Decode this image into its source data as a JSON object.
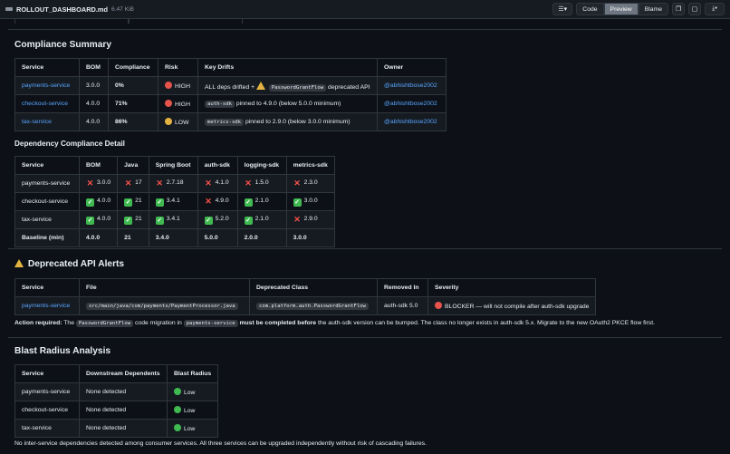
{
  "file": {
    "name": "ROLLOUT_DASHBOARD.md",
    "size": "6.47 KiB"
  },
  "toolbar": {
    "code": "Code",
    "preview": "Preview",
    "blame": "Blame"
  },
  "compliance": {
    "title": "Compliance Summary",
    "headers": [
      "Service",
      "BOM",
      "Compliance",
      "Risk",
      "Key Drifts",
      "Owner"
    ],
    "rows": [
      {
        "service": "payments-service",
        "bom": "3.0.0",
        "compliance": "0%",
        "risk": "HIGH",
        "risk_color": "#e5534b",
        "drift_pre": "ALL deps drifted +",
        "drift_code": "PasswordGrantFlow",
        "drift_post": "deprecated API",
        "owner": "@abhishtbose2002"
      },
      {
        "service": "checkout-service",
        "bom": "4.0.0",
        "compliance": "71%",
        "risk": "HIGH",
        "risk_color": "#e5534b",
        "drift_pre": "",
        "drift_code": "auth-sdk",
        "drift_post": "pinned to 4.9.0 (below 5.0.0 minimum)",
        "owner": "@abhishtbose2002"
      },
      {
        "service": "tax-service",
        "bom": "4.0.0",
        "compliance": "86%",
        "risk": "LOW",
        "risk_color": "#e3b341",
        "drift_pre": "",
        "drift_code": "metrics-sdk",
        "drift_post": "pinned to 2.9.0 (below 3.0.0 minimum)",
        "owner": "@abhishtbose2002"
      }
    ]
  },
  "dependency": {
    "title": "Dependency Compliance Detail",
    "headers": [
      "Service",
      "BOM",
      "Java",
      "Spring Boot",
      "auth-sdk",
      "logging-sdk",
      "metrics-sdk"
    ],
    "rows": [
      {
        "service": "payments-service",
        "cells": [
          {
            "ok": false,
            "v": "3.0.0"
          },
          {
            "ok": false,
            "v": "17"
          },
          {
            "ok": false,
            "v": "2.7.18"
          },
          {
            "ok": false,
            "v": "4.1.0"
          },
          {
            "ok": false,
            "v": "1.5.0"
          },
          {
            "ok": false,
            "v": "2.3.0"
          }
        ]
      },
      {
        "service": "checkout-service",
        "cells": [
          {
            "ok": true,
            "v": "4.0.0"
          },
          {
            "ok": true,
            "v": "21"
          },
          {
            "ok": true,
            "v": "3.4.1"
          },
          {
            "ok": false,
            "v": "4.9.0"
          },
          {
            "ok": true,
            "v": "2.1.0"
          },
          {
            "ok": true,
            "v": "3.0.0"
          }
        ]
      },
      {
        "service": "tax-service",
        "cells": [
          {
            "ok": true,
            "v": "4.0.0"
          },
          {
            "ok": true,
            "v": "21"
          },
          {
            "ok": true,
            "v": "3.4.1"
          },
          {
            "ok": true,
            "v": "5.2.0"
          },
          {
            "ok": true,
            "v": "2.1.0"
          },
          {
            "ok": false,
            "v": "2.9.0"
          }
        ]
      }
    ],
    "baseline": {
      "label": "Baseline (min)",
      "values": [
        "4.0.0",
        "21",
        "3.4.0",
        "5.0.0",
        "2.0.0",
        "3.0.0"
      ]
    }
  },
  "deprecated": {
    "title": "Deprecated API Alerts",
    "headers": [
      "Service",
      "File",
      "Deprecated Class",
      "Removed In",
      "Severity"
    ],
    "row": {
      "service": "payments-service",
      "file": "src/main/java/com/payments/PaymentProcessor.java",
      "klass": "com.platform.auth.PasswordGrantFlow",
      "removed": "auth-sdk 5.0",
      "severity": "BLOCKER — will not compile after auth-sdk upgrade"
    },
    "action": {
      "label": "Action required:",
      "t1": "The",
      "c1": "PasswordGrantFlow",
      "t2": "code migration in",
      "c2": "payments-service",
      "b1": "must be completed before",
      "t3": "the auth-sdk version can be bumped. The class no longer exists in auth-sdk 5.x. Migrate to the new OAuth2 PKCE flow first."
    }
  },
  "blast": {
    "title": "Blast Radius Analysis",
    "headers": [
      "Service",
      "Downstream Dependents",
      "Blast Radius"
    ],
    "rows": [
      {
        "service": "payments-service",
        "deps": "None detected",
        "radius": "Low"
      },
      {
        "service": "checkout-service",
        "deps": "None detected",
        "radius": "Low"
      },
      {
        "service": "tax-service",
        "deps": "None detected",
        "radius": "Low"
      }
    ],
    "note": "No inter-service dependencies detected among consumer services. All three services can be upgraded independently without risk of cascading failures."
  }
}
